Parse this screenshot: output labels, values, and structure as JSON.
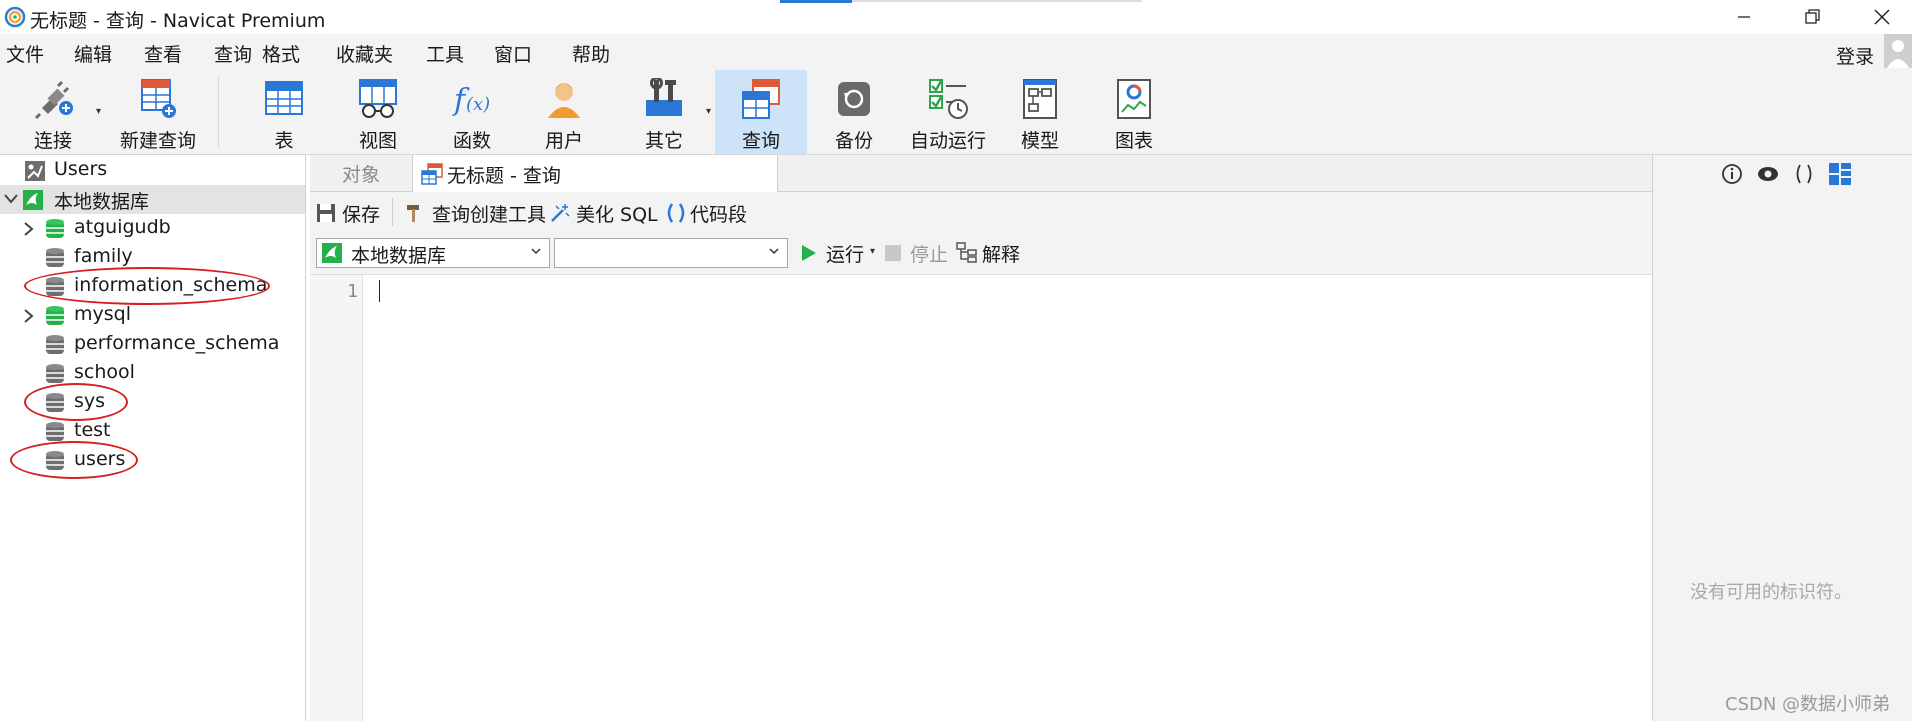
{
  "window": {
    "title": "无标题 - 查询 - Navicat Premium",
    "controls": [
      "minimize",
      "restore",
      "close"
    ]
  },
  "menu": {
    "items": [
      "文件",
      "编辑",
      "查看",
      "查询",
      "格式",
      "收藏夹",
      "工具",
      "窗口",
      "帮助"
    ],
    "login": "登录"
  },
  "toolbar": {
    "items": [
      {
        "label": "连接",
        "icon": "connection-plug-icon"
      },
      {
        "label": "新建查询",
        "icon": "new-query-icon"
      },
      {
        "label": "表",
        "icon": "table-icon"
      },
      {
        "label": "视图",
        "icon": "view-glasses-icon"
      },
      {
        "label": "函数",
        "icon": "function-fx-icon"
      },
      {
        "label": "用户",
        "icon": "user-icon"
      },
      {
        "label": "其它",
        "icon": "tools-icon"
      },
      {
        "label": "查询",
        "icon": "query-icon"
      },
      {
        "label": "备份",
        "icon": "backup-icon"
      },
      {
        "label": "自动运行",
        "icon": "auto-run-icon"
      },
      {
        "label": "模型",
        "icon": "model-icon"
      },
      {
        "label": "图表",
        "icon": "chart-icon"
      }
    ],
    "active": "查询"
  },
  "tree": {
    "nodes": [
      {
        "label": "Users",
        "type": "users-object"
      },
      {
        "label": "本地数据库",
        "type": "connection",
        "expanded": true,
        "selected": true
      },
      {
        "label": "atguigudb",
        "type": "database",
        "open": true,
        "expandable": true
      },
      {
        "label": "family",
        "type": "database"
      },
      {
        "label": "information_schema",
        "type": "database",
        "circled": true
      },
      {
        "label": "mysql",
        "type": "database",
        "open": true,
        "expandable": true
      },
      {
        "label": "performance_schema",
        "type": "database"
      },
      {
        "label": "school",
        "type": "database"
      },
      {
        "label": "sys",
        "type": "database",
        "circled": true
      },
      {
        "label": "test",
        "type": "database"
      },
      {
        "label": "users",
        "type": "database",
        "circled": true
      }
    ]
  },
  "tabs": {
    "objects": "对象",
    "query": "无标题 - 查询"
  },
  "query_toolbar": {
    "save": "保存",
    "query_builder": "查询创建工具",
    "beautify": "美化 SQL",
    "snippet": "代码段"
  },
  "selector": {
    "connection": "本地数据库",
    "database": "",
    "run": "运行",
    "stop": "停止",
    "explain": "解释"
  },
  "editor": {
    "line_numbers": [
      "1"
    ],
    "content": ""
  },
  "right_panel": {
    "empty_text": "没有可用的标识符。",
    "icons": [
      "info-icon",
      "eye-icon",
      "parentheses-icon",
      "grid-layout-icon"
    ]
  },
  "watermark": "CSDN @数据小师弟",
  "colors": {
    "accent_blue": "#2a77d6",
    "active_tool_bg": "#cce3f8",
    "db_open_green": "#25b04a",
    "db_closed_gray": "#6e6e6e",
    "annotation_red": "#d62020"
  }
}
